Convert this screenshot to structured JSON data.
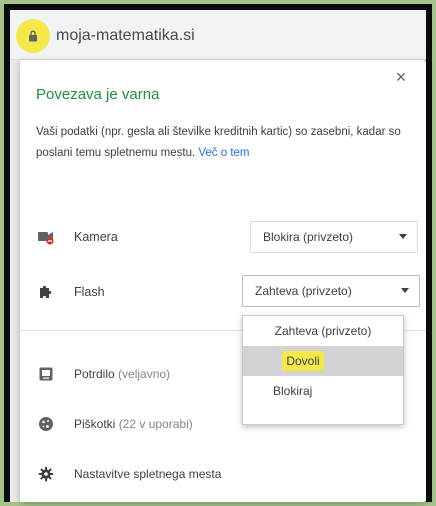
{
  "browser": {
    "site": "moja-matematika.si"
  },
  "popup": {
    "title": "Povezava je varna",
    "description": "Vaši podatki (npr. gesla ali številke kreditnih kartic) so zasebni, kadar so poslani temu spletnemu mestu.",
    "more_link": "Več o tem",
    "close": "×",
    "permissions": [
      {
        "label": "Kamera",
        "value": "Blokira (privzeto)",
        "icon": "camera-blocked-icon"
      },
      {
        "label": "Flash",
        "value": "Zahteva (privzeto)",
        "icon": "puzzle-icon"
      }
    ],
    "info": [
      {
        "label": "Potrdilo",
        "sub": "(veljavno)",
        "icon": "certificate-icon"
      },
      {
        "label": "Piškotki",
        "sub": "(22 v uporabi)",
        "icon": "cookie-icon"
      },
      {
        "label": "Nastavitve spletnega mesta",
        "sub": "",
        "icon": "gear-icon"
      }
    ],
    "dropdown": {
      "options": [
        "Zahteva (privzeto)",
        "Dovoli",
        "Blokiraj"
      ],
      "highlighted": "Dovoli"
    }
  },
  "colors": {
    "accent_green": "#1e8e3e",
    "highlight_yellow": "#f5e94a",
    "link_blue": "#1a73e8"
  }
}
